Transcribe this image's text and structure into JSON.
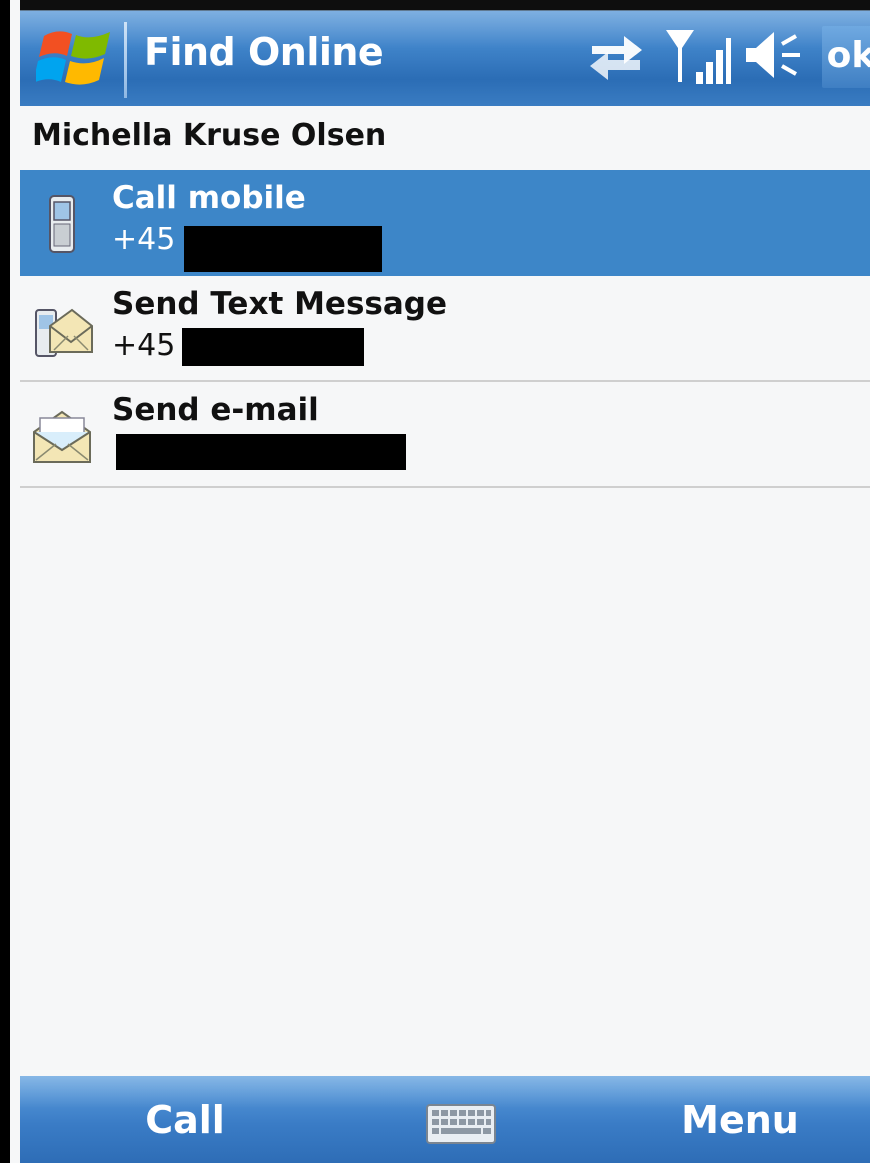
{
  "titlebar": {
    "title": "Find Online",
    "icons": [
      "windows-logo-icon",
      "sync-icon",
      "signal-icon",
      "volume-icon"
    ],
    "ok_label": "ok"
  },
  "contact": {
    "name": "Michella Kruse Olsen"
  },
  "actions": [
    {
      "label": "Call mobile",
      "value": "+45",
      "icon": "phone-icon",
      "selected": true
    },
    {
      "label": "Send Text Message",
      "value": "+45",
      "icon": "text-message-icon",
      "selected": false
    },
    {
      "label": "Send e-mail",
      "value": "",
      "icon": "email-icon",
      "selected": false
    }
  ],
  "softkeys": {
    "left": "Call",
    "right": "Menu",
    "center_icon": "keyboard-icon"
  },
  "colors": {
    "titlebar": "#3f83c9",
    "selection": "#3d86c8",
    "background": "#f6f7f8"
  }
}
